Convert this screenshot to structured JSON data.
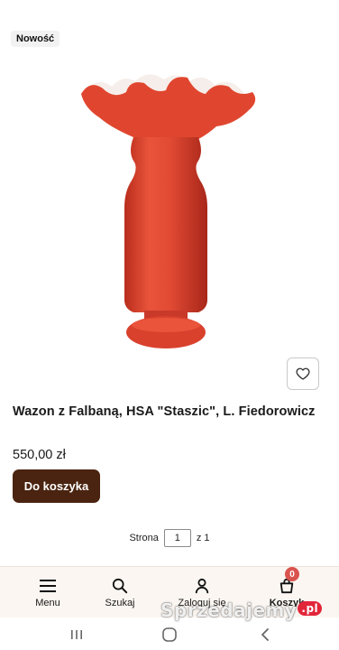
{
  "badge": {
    "label": "Nowość"
  },
  "product": {
    "image_alt": "red vase with ruffled rim",
    "title": "Wazon z Falbaną, HSA \"Staszic\", L. Fiedorowicz",
    "price": "550,00 zł",
    "add_to_cart_label": "Do koszyka"
  },
  "pager": {
    "prefix": "Strona",
    "current": "1",
    "suffix": "z 1"
  },
  "nav": {
    "items": [
      {
        "label": "Menu",
        "icon": "hamburger-icon"
      },
      {
        "label": "Szukaj",
        "icon": "search-icon"
      },
      {
        "label": "Zaloguj się",
        "icon": "user-icon"
      },
      {
        "label": "Koszyk",
        "icon": "cart-icon"
      }
    ],
    "cart_count": "0"
  },
  "watermark": {
    "text": "Sprzedajemy",
    "suffix": ".pl"
  },
  "colors": {
    "accent": "#4a2410",
    "vase": "#e0462f",
    "badge_red": "#d9534f",
    "nav_bg": "#fbf6f1"
  }
}
